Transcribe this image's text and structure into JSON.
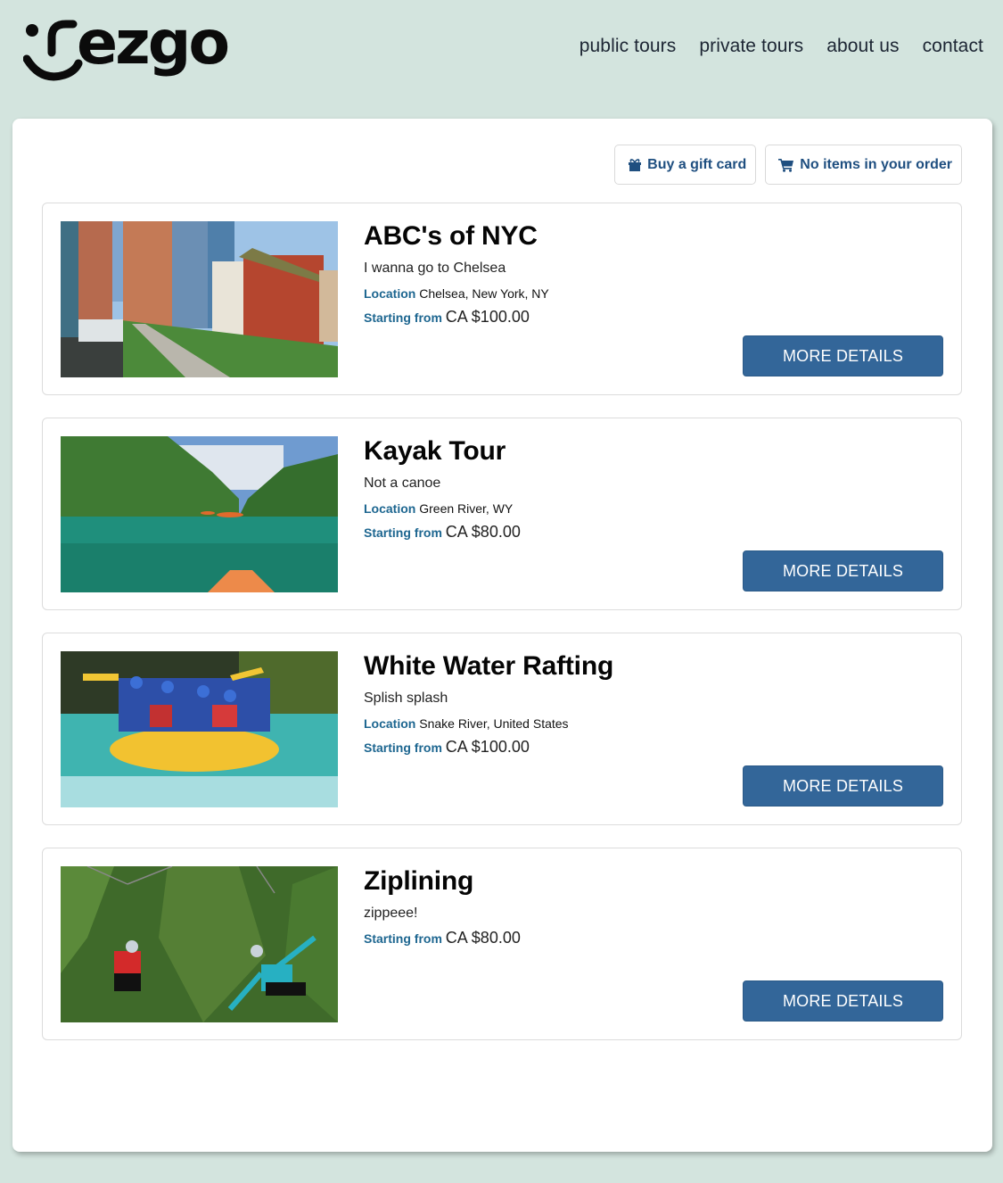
{
  "brand": {
    "logo_text": "rezgo",
    "background_color": "#d3e4de",
    "accent_color": "#336699",
    "label_color": "#1d6690"
  },
  "nav": {
    "items": [
      {
        "label": "public tours"
      },
      {
        "label": "private tours"
      },
      {
        "label": "about us"
      },
      {
        "label": "contact"
      }
    ]
  },
  "toolbar": {
    "gift_card_label": "Buy a gift card",
    "gift_icon": "gift-icon",
    "cart_label": "No items in your order",
    "cart_icon": "shopping-cart-icon"
  },
  "labels": {
    "location": "Location",
    "starting_from": "Starting from",
    "more_details": "MORE DETAILS"
  },
  "tours": [
    {
      "title": "ABC's of NYC",
      "description": "I wanna go to Chelsea",
      "location": "Chelsea, New York, NY",
      "price": "CA $100.00",
      "image": "city street with high-line park and red brick building"
    },
    {
      "title": "Kayak Tour",
      "description": "Not a canoe",
      "location": "Green River, WY",
      "price": "CA $80.00",
      "image": "kayaks on turquoise river through mangroves"
    },
    {
      "title": "White Water Rafting",
      "description": "Splish splash",
      "location": "Snake River, United States",
      "price": "CA $100.00",
      "image": "yellow raft with people in blue helmets"
    },
    {
      "title": "Ziplining",
      "description": "zippeee!",
      "location": null,
      "price": "CA $80.00",
      "image": "two people ziplining over forest"
    }
  ]
}
